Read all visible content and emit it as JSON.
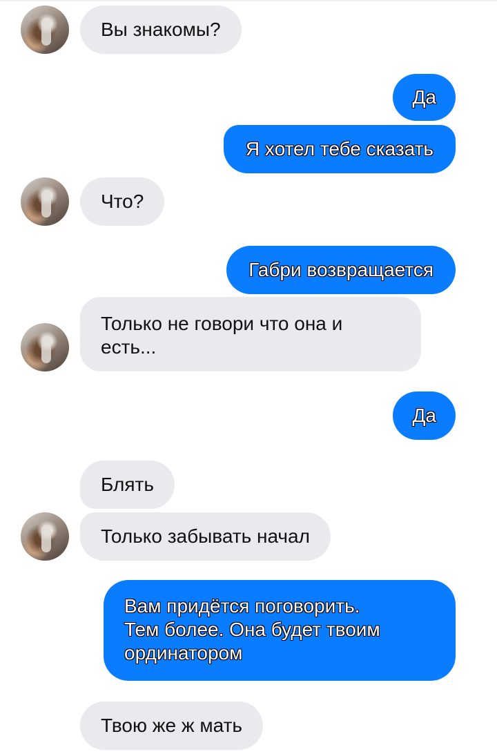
{
  "messages": [
    {
      "side": "in",
      "text": "Вы знакомы?"
    },
    {
      "side": "out",
      "text": "Да"
    },
    {
      "side": "out",
      "text": "Я хотел тебе сказать"
    },
    {
      "side": "in",
      "text": "Что?"
    },
    {
      "side": "out",
      "text": "Габри возвращается"
    },
    {
      "side": "in",
      "lines": [
        "Только не говори что она и",
        "есть..."
      ]
    },
    {
      "side": "out",
      "text": "Да"
    },
    {
      "side": "in",
      "text": "Блять"
    },
    {
      "side": "in",
      "text": "Только забывать начал"
    },
    {
      "side": "out",
      "lines": [
        "Вам придётся поговорить.",
        "Тем более. Она будет твоим",
        "ординатором"
      ]
    },
    {
      "side": "in",
      "text": "Твою же ж мать"
    }
  ],
  "colors": {
    "incoming_bubble": "#e9e9ee",
    "outgoing_bubble": "#0a7cff"
  },
  "icons": {
    "contact_avatar": "contact-avatar-photo"
  }
}
